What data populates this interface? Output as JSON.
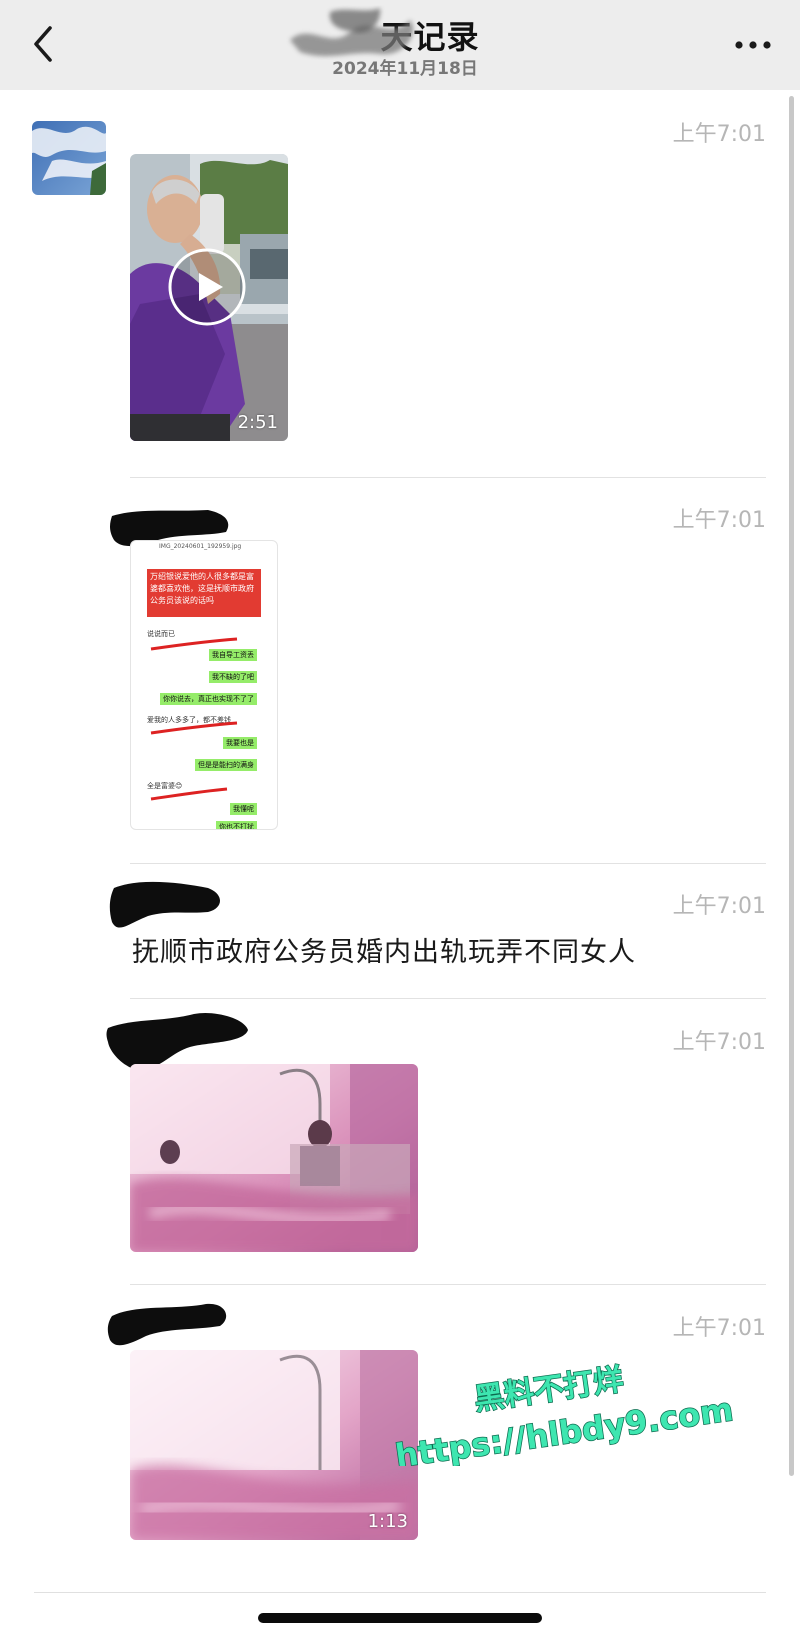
{
  "header": {
    "title": "天记录",
    "date": "2024年11月18日",
    "back_icon": "chevron-left-icon",
    "more_icon": "more-dots-icon"
  },
  "messages": [
    {
      "time": "上午7:01",
      "type": "video",
      "duration": "2:51"
    },
    {
      "time": "上午7:01",
      "type": "image"
    },
    {
      "time": "上午7:01",
      "type": "text",
      "text": "抚顺市政府公务员婚内出轨玩弄不同女人"
    },
    {
      "time": "上午7:01",
      "type": "image"
    },
    {
      "time": "上午7:01",
      "type": "video",
      "duration": "1:13"
    }
  ],
  "screenshot_thumb": {
    "filename": "IMG_20240601_192959.jpg",
    "red_text": "万绍银说爱他的人很多都是富婆都喜欢他，这是抚顺市政府公务员该说的话吗",
    "bubbles": [
      "说说而已",
      "我自导工资丢",
      "我不缺的了吧",
      "你你说去，真正也实现不了了",
      "爱我的人多多了，都不差钱",
      "我要也是",
      "但是是能扫的满身",
      "全是富婆😊",
      "我懂呢",
      "你也不打扰"
    ]
  },
  "watermark": {
    "line1": "黑料不打烊",
    "line2": "https://hlbdy9.com"
  }
}
